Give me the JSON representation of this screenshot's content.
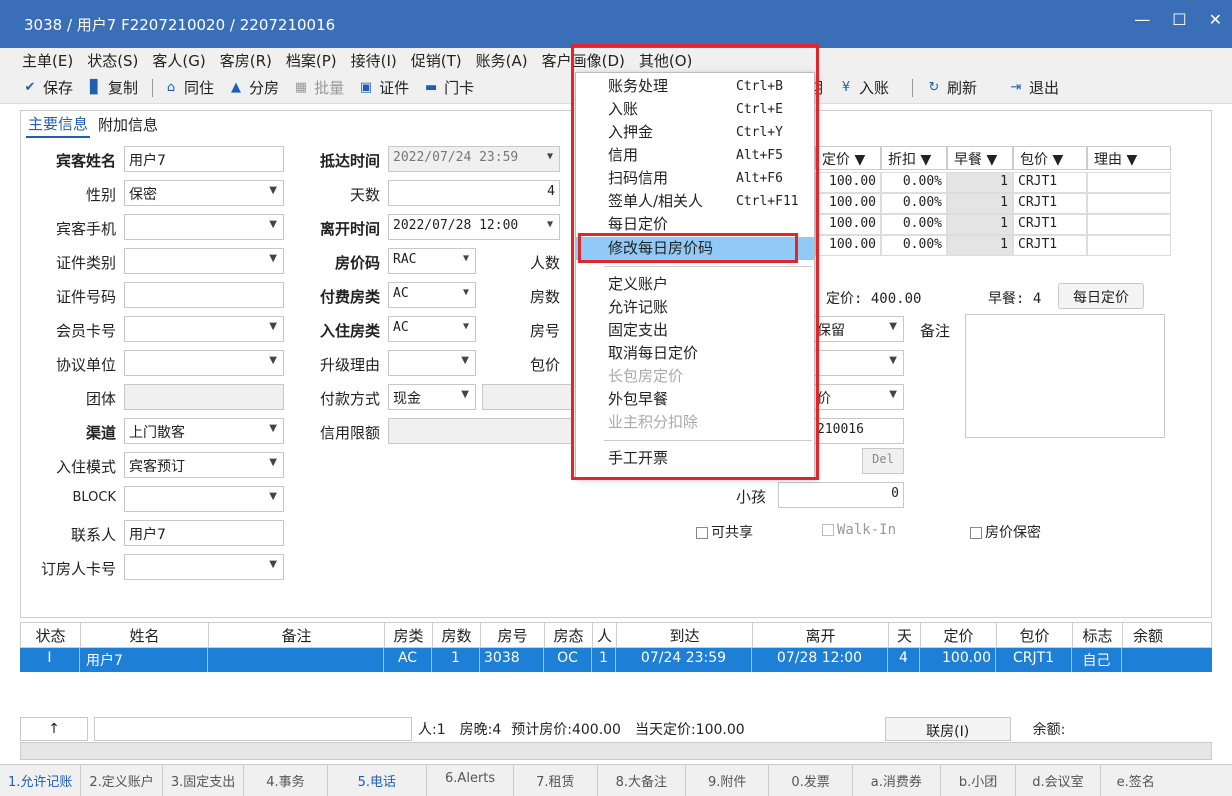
{
  "title": "3038 / 用户7 F2207210020 / 2207210016",
  "window_ctrls": {
    "min": "—",
    "max": "☐",
    "close": "✕"
  },
  "menubar": [
    "主单(E)",
    "状态(S)",
    "客人(G)",
    "客房(R)",
    "档案(P)",
    "接待(I)",
    "促销(T)",
    "账务(A)",
    "客户画像(D)",
    "其他(O)"
  ],
  "toolbar": {
    "save": "保存",
    "copy": "复制",
    "cohab": "同住",
    "split": "分房",
    "batch": "批量",
    "cert": "证件",
    "card": "门卡",
    "entry": "入账",
    "refresh": "刷新",
    "exit": "退出",
    "partial": "期"
  },
  "tabs": {
    "main": "主要信息",
    "extra": "附加信息"
  },
  "form": {
    "guest_name_lbl": "宾客姓名",
    "guest_name": "用户7",
    "gender_lbl": "性别",
    "gender": "保密",
    "phone_lbl": "宾客手机",
    "phone": "",
    "idtype_lbl": "证件类别",
    "idtype": "",
    "idno_lbl": "证件号码",
    "idno": "",
    "member_lbl": "会员卡号",
    "member": "",
    "agreement_lbl": "协议单位",
    "agreement": "",
    "group_lbl": "团体",
    "group": "",
    "channel_lbl": "渠道",
    "channel": "上门散客",
    "mode_lbl": "入住模式",
    "mode": "宾客预订",
    "block_lbl": "BLOCK",
    "block": "",
    "contact_lbl": "联系人",
    "contact": "用户7",
    "booker_lbl": "订房人卡号",
    "booker": "",
    "arrive_lbl": "抵达时间",
    "arrive": "2022/07/24 23:59",
    "days_lbl": "天数",
    "days": "4",
    "leave_lbl": "离开时间",
    "leave": "2022/07/28 12:00",
    "ratecode_lbl": "房价码",
    "ratecode": "RAC",
    "paytype_lbl": "付费房类",
    "paytype": "AC",
    "roomtype_lbl": "入住房类",
    "roomtype": "AC",
    "upgrade_lbl": "升级理由",
    "upgrade": "",
    "payment_lbl": "付款方式",
    "payment": "现金",
    "credit_lbl": "信用限额",
    "credit": "",
    "persons_lbl": "人数",
    "rooms_lbl": "房数",
    "roomno_lbl": "房号",
    "package_lbl": "包价",
    "child_lbl": "小孩",
    "child": "0",
    "keep": "保留",
    "price_short": "价",
    "refno": "210016",
    "remark_lbl": "备注",
    "del": "Del",
    "share": "可共享",
    "walkin": "Walk-In",
    "ratesecret": "房价保密"
  },
  "rategrid": {
    "headers": [
      "定价 ▼",
      "折扣 ▼",
      "早餐 ▼",
      "包价 ▼",
      "理由 ▼"
    ],
    "rows": [
      {
        "price": "100.00",
        "disc": "0.00%",
        "bf": "1",
        "pkg": "CRJT1"
      },
      {
        "price": "100.00",
        "disc": "0.00%",
        "bf": "1",
        "pkg": "CRJT1"
      },
      {
        "price": "100.00",
        "disc": "0.00%",
        "bf": "1",
        "pkg": "CRJT1"
      },
      {
        "price": "100.00",
        "disc": "0.00%",
        "bf": "1",
        "pkg": "CRJT1"
      }
    ],
    "summary_price": "定价: 400.00",
    "summary_bf": "早餐: 4",
    "daily_btn": "每日定价"
  },
  "menu": {
    "items": [
      {
        "label": "账务处理",
        "sc": "Ctrl+B",
        "dis": false
      },
      {
        "label": "入账",
        "sc": "Ctrl+E",
        "dis": false
      },
      {
        "label": "入押金",
        "sc": "Ctrl+Y",
        "dis": false
      },
      {
        "label": "信用",
        "sc": "Alt+F5",
        "dis": false
      },
      {
        "label": "扫码信用",
        "sc": "Alt+F6",
        "dis": false
      },
      {
        "label": "签单人/相关人",
        "sc": "Ctrl+F11",
        "dis": false
      },
      {
        "label": "每日定价",
        "sc": "",
        "dis": false
      },
      {
        "label": "修改每日房价码",
        "sc": "",
        "dis": false,
        "hl": true
      },
      {
        "label": "定义账户",
        "sc": "",
        "dis": false
      },
      {
        "label": "允许记账",
        "sc": "",
        "dis": false
      },
      {
        "label": "固定支出",
        "sc": "",
        "dis": false
      },
      {
        "label": "取消每日定价",
        "sc": "",
        "dis": false
      },
      {
        "label": "长包房定价",
        "sc": "",
        "dis": true
      },
      {
        "label": "外包早餐",
        "sc": "",
        "dis": false
      },
      {
        "label": "业主积分扣除",
        "sc": "",
        "dis": true
      },
      {
        "label": "手工开票",
        "sc": "",
        "dis": false
      }
    ]
  },
  "list": {
    "headers": [
      "状态",
      "姓名",
      "备注",
      "房类",
      "房数",
      "房号",
      "房态",
      "人",
      "到达",
      "离开",
      "天",
      "定价",
      "包价",
      "标志",
      "余额"
    ],
    "row": [
      "I",
      "用户7",
      "",
      "AC",
      "1",
      "3038",
      "OC",
      "1",
      "07/24 23:59",
      "07/28 12:00",
      "4",
      "100.00",
      "CRJT1",
      "自己",
      ""
    ]
  },
  "status": {
    "up": "↑",
    "persons": "人:1",
    "nights": "房晚:4",
    "est": "预计房价:400.00",
    "today": "当天定价:100.00",
    "link": "联房(I)",
    "balance": "余额:"
  },
  "bottomtabs": [
    "1.允许记账",
    "2.定义账户",
    "3.固定支出",
    "4.事务",
    "5.电话",
    "6.Alerts",
    "7.租赁",
    "8.大备注",
    "9.附件",
    "0.发票",
    "a.消费券",
    "b.小团",
    "d.会议室",
    "e.签名"
  ]
}
